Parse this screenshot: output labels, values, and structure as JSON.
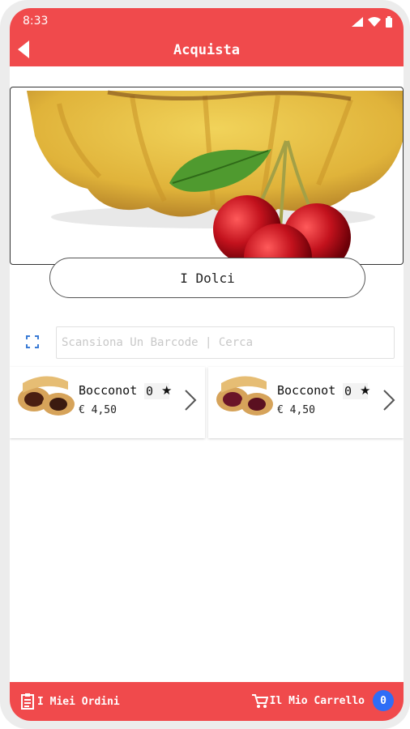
{
  "status_bar": {
    "time": "8:33"
  },
  "app_bar": {
    "title": "Acquista"
  },
  "category": {
    "label": "I Dolci"
  },
  "search": {
    "placeholder": "Scansiona Un Barcode | Cerca",
    "value": ""
  },
  "products": [
    {
      "name": "Bocconot",
      "count": "0",
      "star": "★",
      "price": "€ 4,50"
    },
    {
      "name": "Bocconot",
      "count": "0",
      "star": "★",
      "price": "€ 4,50"
    }
  ],
  "bottom_bar": {
    "orders_label": "I Miei Ordini",
    "cart_label": "Il Mio Carrello",
    "cart_count": "0"
  },
  "colors": {
    "primary": "#f04a4c",
    "badge": "#2f6df6"
  },
  "icons": [
    "back-arrow-icon",
    "signal-icon",
    "wifi-icon",
    "battery-icon",
    "scan-icon",
    "chevron-right-icon",
    "orders-icon",
    "cart-icon"
  ]
}
